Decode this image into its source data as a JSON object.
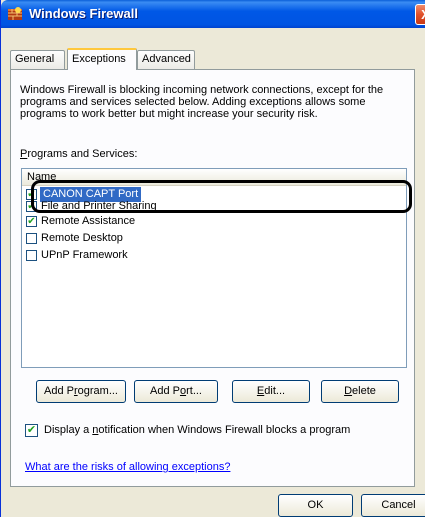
{
  "window": {
    "title": "Windows Firewall",
    "close_glyph": "X"
  },
  "tabs": [
    {
      "pre": "",
      "accel": "",
      "post": "General"
    },
    {
      "pre": "Exceptions",
      "accel": "",
      "post": ""
    },
    {
      "pre": "Advanced",
      "accel": "",
      "post": ""
    }
  ],
  "description": "Windows Firewall is blocking incoming network connections, except for the programs and services selected below. Adding exceptions allows some programs to work better but might increase your security risk.",
  "programs": {
    "label_accel": "P",
    "label_rest": "rograms and Services:",
    "header": "Name",
    "items": [
      {
        "label": "CANON CAPT Port",
        "checked": true
      },
      {
        "label": "File and Printer Sharing",
        "checked": true
      },
      {
        "label": "Remote Assistance",
        "checked": true
      },
      {
        "label": "Remote Desktop",
        "checked": false
      },
      {
        "label": "UPnP Framework",
        "checked": false
      }
    ]
  },
  "buttons": {
    "add_program": {
      "pre": "Add P",
      "accel": "r",
      "post": "ogram..."
    },
    "add_port": {
      "pre": "Add P",
      "accel": "o",
      "post": "rt..."
    },
    "edit": {
      "pre": "",
      "accel": "E",
      "post": "dit..."
    },
    "delete": {
      "pre": "",
      "accel": "D",
      "post": "elete"
    }
  },
  "notification": {
    "pre": "Display a ",
    "accel": "n",
    "post": "otification when Windows Firewall blocks a program",
    "checked": true
  },
  "risk_link": "What are the risks of allowing exceptions?",
  "footer": {
    "ok": "OK",
    "cancel": "Cancel"
  },
  "check_glyph": "✔",
  "colors": {
    "titlebar": "#0054e3",
    "selection": "#316ac5",
    "link": "#0000ff",
    "active_tab_accent": "#ffc83c"
  }
}
